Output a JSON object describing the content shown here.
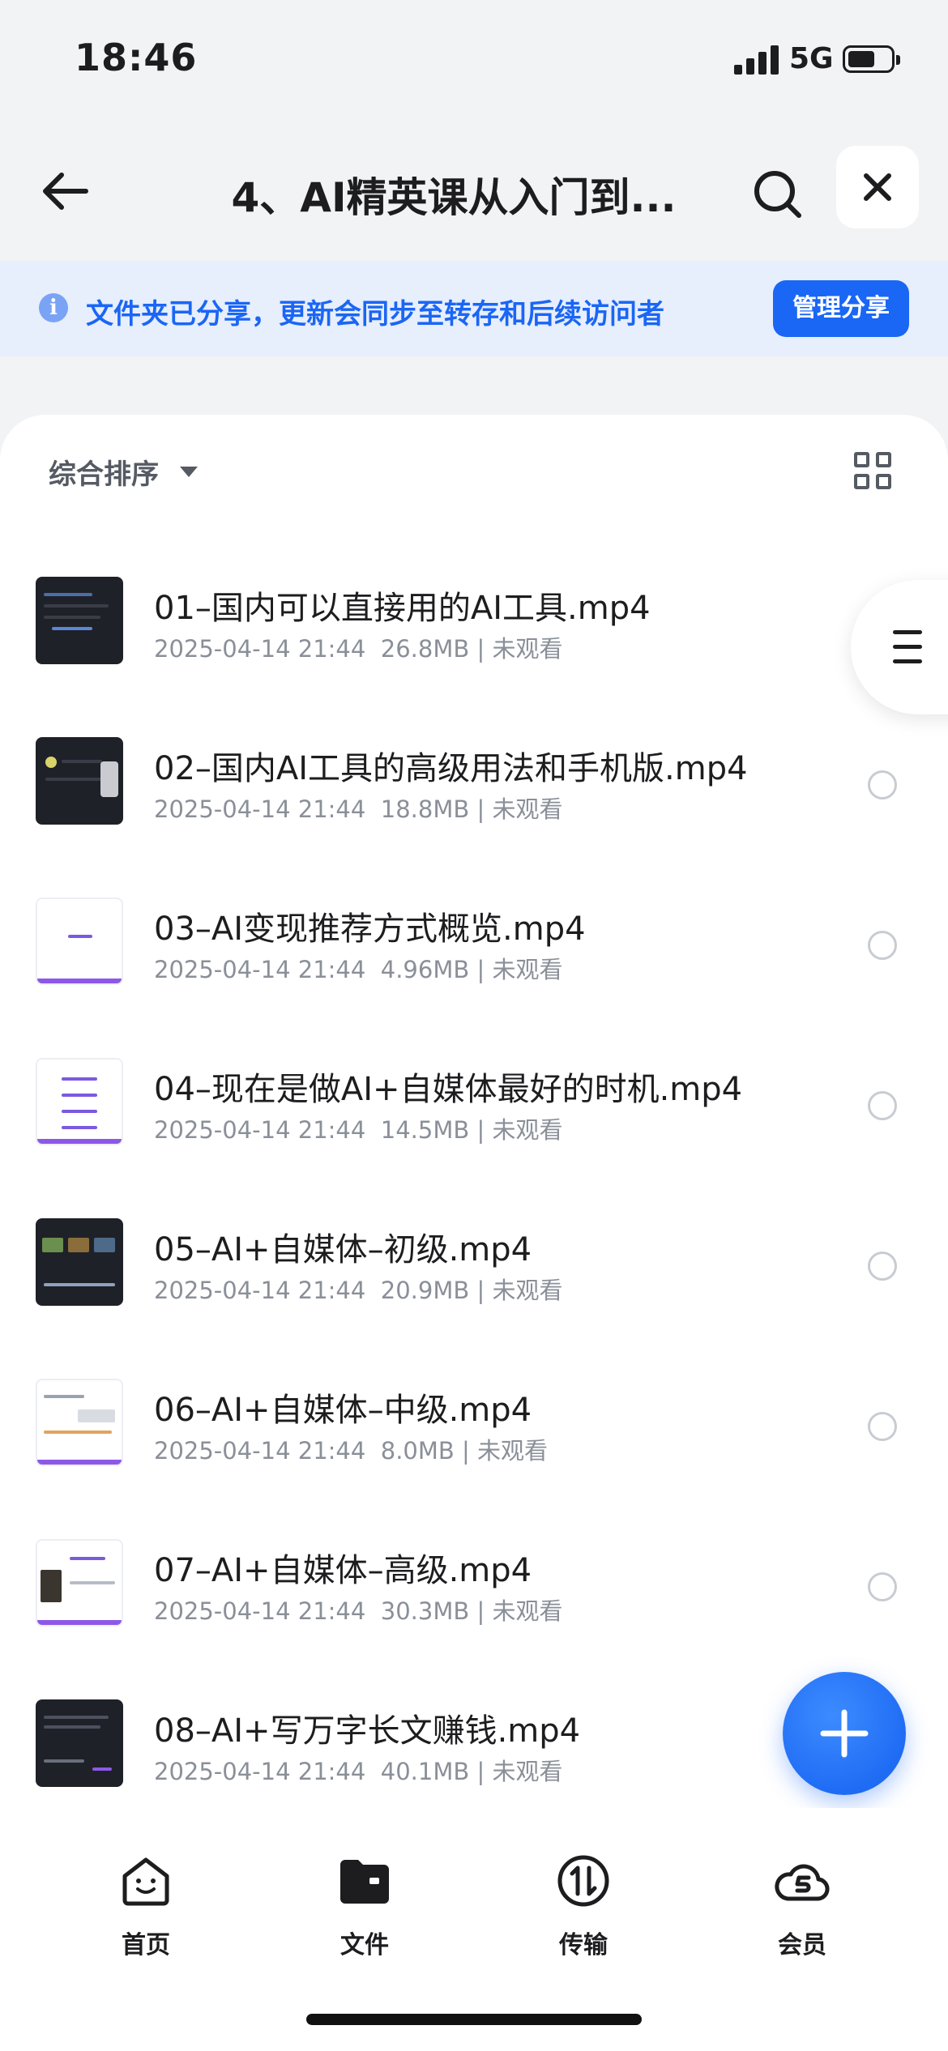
{
  "status_bar": {
    "time": "18:46",
    "network": "5G",
    "battery_level": 0.62
  },
  "header": {
    "title": "4、AI精英课从入门到...",
    "back_icon": "back-arrow-icon",
    "search_icon": "search-icon",
    "close_icon": "close-icon"
  },
  "share_notice": {
    "icon": "info-icon",
    "info_glyph": "i",
    "text": "文件夹已分享，更新会同步至转存和后续访问者",
    "button_label": "管理分享"
  },
  "toolbar": {
    "sort_label": "综合排序",
    "view_toggle_icon": "grid-view-icon"
  },
  "files": [
    {
      "name": "01–国内可以直接用的AI工具.mp4",
      "date": "2025-04-14 21:44",
      "size": "26.8MB",
      "sep": "|",
      "status": "未观看"
    },
    {
      "name": "02–国内AI工具的高级用法和手机版.mp4",
      "date": "2025-04-14 21:44",
      "size": "18.8MB",
      "sep": "|",
      "status": "未观看"
    },
    {
      "name": "03–AI变现推荐方式概览.mp4",
      "date": "2025-04-14 21:44",
      "size": "4.96MB",
      "sep": "|",
      "status": "未观看"
    },
    {
      "name": "04–现在是做AI+自媒体最好的时机.mp4",
      "date": "2025-04-14 21:44",
      "size": "14.5MB",
      "sep": "|",
      "status": "未观看"
    },
    {
      "name": "05–AI+自媒体–初级.mp4",
      "date": "2025-04-14 21:44",
      "size": "20.9MB",
      "sep": "|",
      "status": "未观看"
    },
    {
      "name": "06–AI+自媒体–中级.mp4",
      "date": "2025-04-14 21:44",
      "size": "8.0MB",
      "sep": "|",
      "status": "未观看"
    },
    {
      "name": "07–AI+自媒体–高级.mp4",
      "date": "2025-04-14 21:44",
      "size": "30.3MB",
      "sep": "|",
      "status": "未观看"
    },
    {
      "name": "08–AI+写万字长文赚钱.mp4",
      "date": "2025-04-14 21:44",
      "size": "40.1MB",
      "sep": "|",
      "status": "未观看"
    }
  ],
  "floating": {
    "menu_icon": "menu-icon",
    "add_icon": "plus-icon"
  },
  "tabs": [
    {
      "label": "首页",
      "icon": "home-face-icon"
    },
    {
      "label": "文件",
      "icon": "folder-icon"
    },
    {
      "label": "传输",
      "icon": "transfer-icon"
    },
    {
      "label": "会员",
      "icon": "vip-cloud-icon"
    }
  ],
  "colors": {
    "accent": "#1a66f5",
    "banner_bg": "#e7eefc",
    "page_bg": "#f2f3f5",
    "meta_text": "#8a8f98"
  }
}
